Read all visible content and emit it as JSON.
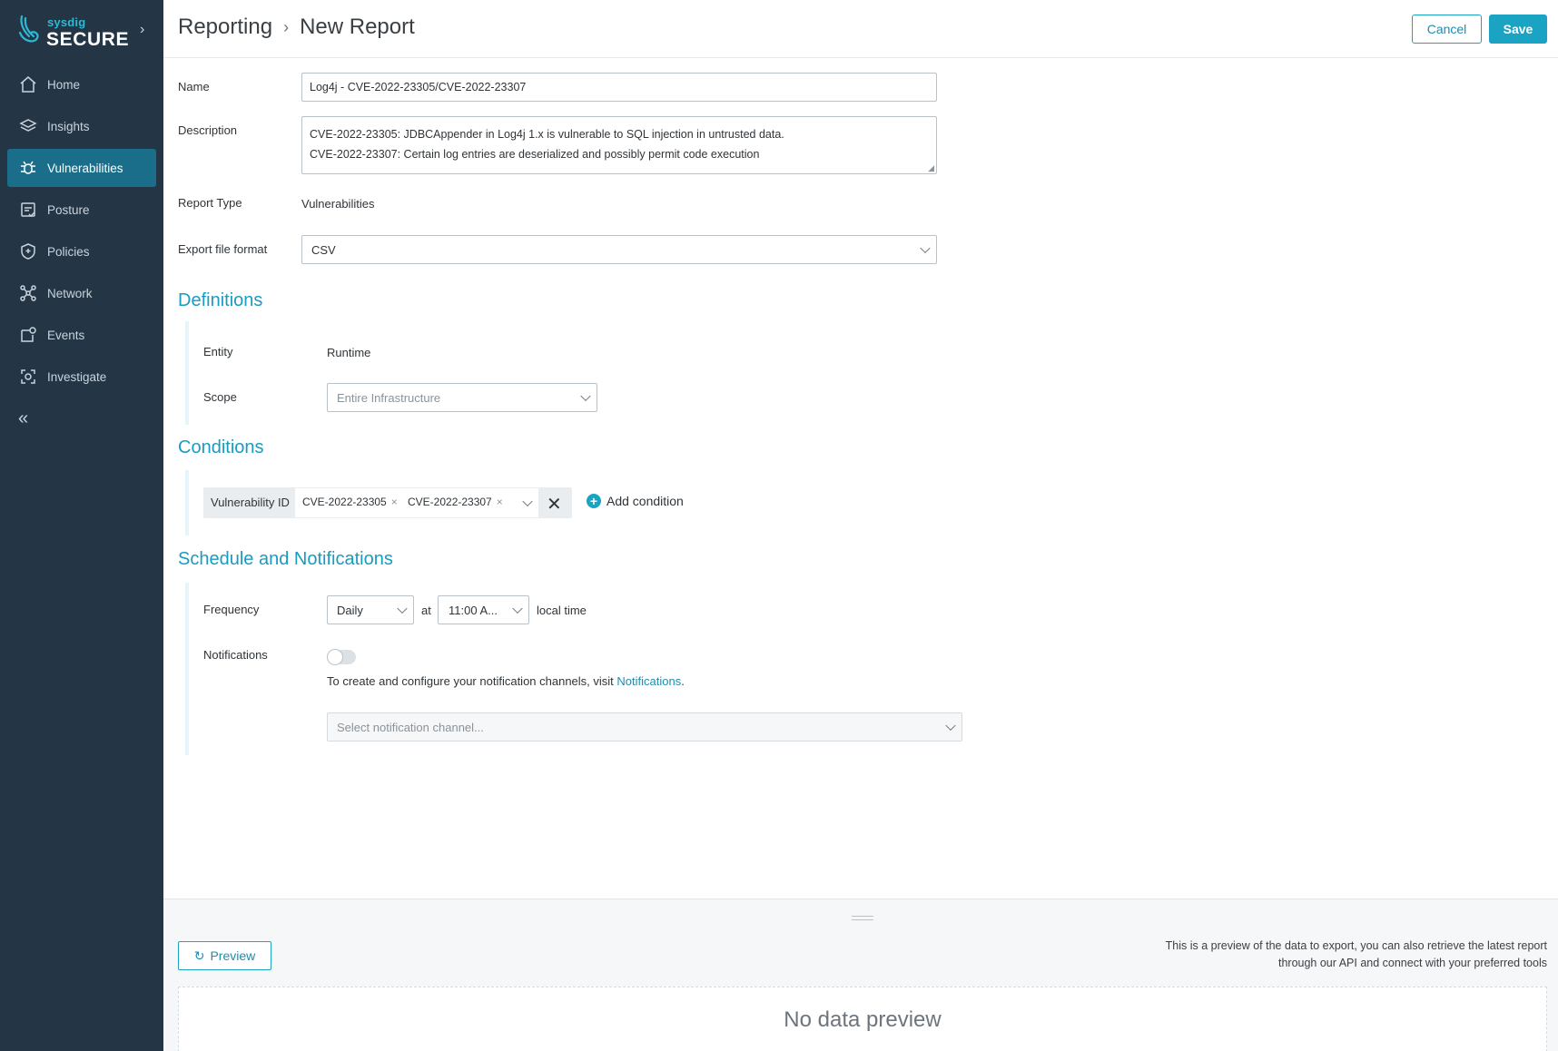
{
  "brand": {
    "small": "sysdig",
    "large": "SECURE",
    "expand_icon": "chevron-right-icon"
  },
  "sidebar": {
    "items": [
      {
        "label": "Home",
        "icon": "home-icon"
      },
      {
        "label": "Insights",
        "icon": "layers-icon"
      },
      {
        "label": "Vulnerabilities",
        "icon": "bug-icon",
        "active": true
      },
      {
        "label": "Posture",
        "icon": "checklist-icon"
      },
      {
        "label": "Policies",
        "icon": "shield-icon"
      },
      {
        "label": "Network",
        "icon": "network-icon"
      },
      {
        "label": "Events",
        "icon": "events-icon"
      },
      {
        "label": "Investigate",
        "icon": "investigate-icon"
      }
    ],
    "collapse_icon": "double-chevron-left-icon"
  },
  "header": {
    "crumb_parent": "Reporting",
    "crumb_current": "New Report",
    "cancel_label": "Cancel",
    "save_label": "Save"
  },
  "form": {
    "name_label": "Name",
    "name_value": "Log4j - CVE-2022-23305/CVE-2022-23307",
    "description_label": "Description",
    "description_value": "CVE-2022-23305: JDBCAppender in Log4j 1.x is vulnerable to SQL injection in untrusted data.\nCVE-2022-23307: Certain log entries are deserialized and possibly permit code execution",
    "report_type_label": "Report Type",
    "report_type_value": "Vulnerabilities",
    "export_label": "Export file format",
    "export_value": "CSV"
  },
  "definitions": {
    "title": "Definitions",
    "entity_label": "Entity",
    "entity_value": "Runtime",
    "scope_label": "Scope",
    "scope_placeholder": "Entire Infrastructure"
  },
  "conditions": {
    "title": "Conditions",
    "field_label": "Vulnerability ID",
    "tags": [
      "CVE-2022-23305",
      "CVE-2022-23307"
    ],
    "add_label": "Add condition"
  },
  "schedule": {
    "title": "Schedule and Notifications",
    "frequency_label": "Frequency",
    "frequency_value": "Daily",
    "at_label": "at",
    "time_value": "11:00 A...",
    "local_time_label": "local time",
    "notifications_label": "Notifications",
    "notifications_enabled": false,
    "notif_text_prefix": "To create and configure your notification channels, visit ",
    "notif_link": "Notifications",
    "notif_text_suffix": ".",
    "channel_placeholder": "Select notification channel..."
  },
  "preview": {
    "button_label": "Preview",
    "note_line1": "This is a preview of the data to export, you can also retrieve the latest report",
    "note_line2": "through our API and connect with your preferred tools",
    "empty_text": "No data preview"
  },
  "colors": {
    "sidebar_bg": "#243646",
    "accent": "#1aa3c3",
    "active_nav": "#1b6e8a"
  }
}
